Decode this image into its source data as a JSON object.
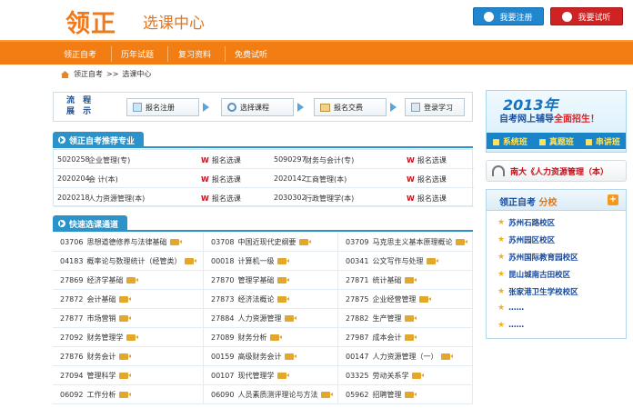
{
  "header": {
    "logo": "领正",
    "subtitle": "选课中心",
    "register_button": "我要注册",
    "trial_button": "我要试听"
  },
  "nav": {
    "items": [
      "领正自考",
      "历年试题",
      "复习资料",
      "免费试听"
    ]
  },
  "breadcrumb": {
    "home": "领正自考",
    "separator": ">>",
    "current": "选课中心"
  },
  "flow": {
    "label_line1": "流 程",
    "label_line2": "展 示",
    "steps": [
      "报名注册",
      "选择课程",
      "报名交费",
      "登录学习"
    ]
  },
  "recommend": {
    "title": "领正自考推荐专业",
    "enroll_label": "报名选课",
    "rows": [
      {
        "left_code": "5020258",
        "left_name": "企业管理(专)",
        "right_code": "5090297",
        "right_name": "财务与会计(专)"
      },
      {
        "left_code": "2020204",
        "left_name": "会 计(本)",
        "right_code": "2020142",
        "right_name": "工商管理(本)"
      },
      {
        "left_code": "2020218",
        "left_name": "人力资源管理(本)",
        "right_code": "2030302",
        "right_name": "行政管理学(本)"
      }
    ]
  },
  "fast": {
    "title": "快速选课通道",
    "rows": [
      [
        {
          "code": "03706",
          "name": "思想道德修养与法律基础"
        },
        {
          "code": "03708",
          "name": "中国近现代史纲要"
        },
        {
          "code": "03709",
          "name": "马克思主义基本原理概论"
        }
      ],
      [
        {
          "code": "04183",
          "name": "概率论与数理统计（经管类）"
        },
        {
          "code": "00018",
          "name": "计算机一级"
        },
        {
          "code": "00341",
          "name": "公文写作与处理"
        }
      ],
      [
        {
          "code": "27869",
          "name": "经济学基础"
        },
        {
          "code": "27870",
          "name": "管理学基础"
        },
        {
          "code": "27871",
          "name": "统计基础"
        }
      ],
      [
        {
          "code": "27872",
          "name": "会计基础"
        },
        {
          "code": "27873",
          "name": "经济法概论"
        },
        {
          "code": "27875",
          "name": "企业经营管理"
        }
      ],
      [
        {
          "code": "27877",
          "name": "市场营销"
        },
        {
          "code": "27884",
          "name": "人力资源管理"
        },
        {
          "code": "27882",
          "name": "生产管理"
        }
      ],
      [
        {
          "code": "27092",
          "name": "财务管理学"
        },
        {
          "code": "27089",
          "name": "财务分析"
        },
        {
          "code": "27987",
          "name": "成本会计"
        }
      ],
      [
        {
          "code": "27876",
          "name": "财务会计"
        },
        {
          "code": "00159",
          "name": "高级财务会计"
        },
        {
          "code": "00147",
          "name": "人力资源管理（一）"
        }
      ],
      [
        {
          "code": "27094",
          "name": "管理科学"
        },
        {
          "code": "00107",
          "name": "现代管理学"
        },
        {
          "code": "03325",
          "name": "劳动关系学"
        }
      ],
      [
        {
          "code": "06092",
          "name": "工作分析"
        },
        {
          "code": "06090",
          "name": "人员素质测评理论与方法"
        },
        {
          "code": "05962",
          "name": "招聘管理"
        }
      ]
    ]
  },
  "banner": {
    "year": "2013年",
    "line_prefix": "自考网上辅导",
    "line_highlight": "全面招生！",
    "tags": [
      "系统班",
      "真题班",
      "串讲班"
    ]
  },
  "nanda": {
    "text": "南大《人力资源管理（本）"
  },
  "branches": {
    "title_prefix": "领正自考",
    "title_suffix": "分校",
    "plus": "+",
    "items": [
      "苏州石路校区",
      "苏州园区校区",
      "苏州国际教育园校区",
      "昆山城南古田校区",
      "张家港卫生学校校区",
      "……",
      "……"
    ]
  },
  "colors": {
    "brand_orange": "#f27d12",
    "accent_blue": "#2b93c9",
    "register_blue": "#1f86cf",
    "trial_red": "#cf2222"
  }
}
